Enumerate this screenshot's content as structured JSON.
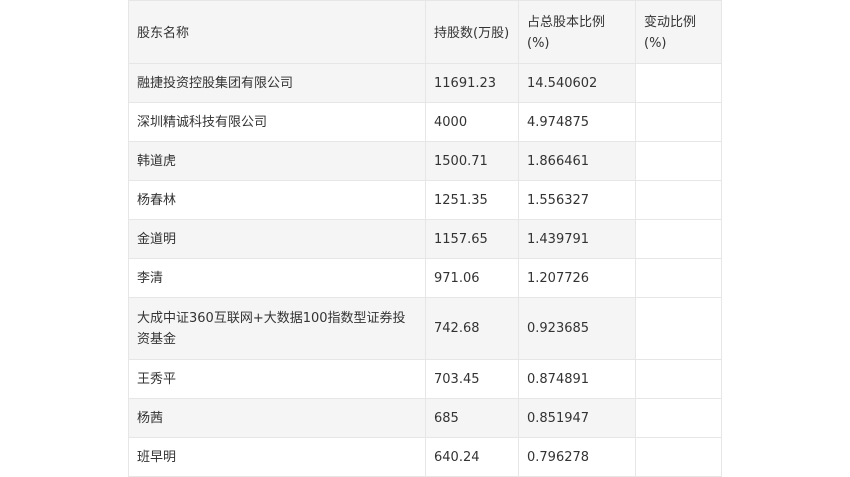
{
  "table": {
    "headers": [
      "股东名称",
      "持股数(万股)",
      "占总股本比例(%)",
      "变动比例(%)"
    ],
    "rows": [
      {
        "name": "融捷投资控股集团有限公司",
        "shares": "11691.23",
        "ratio": "14.540602",
        "change": ""
      },
      {
        "name": "深圳精诚科技有限公司",
        "shares": "4000",
        "ratio": "4.974875",
        "change": ""
      },
      {
        "name": "韩道虎",
        "shares": "1500.71",
        "ratio": "1.866461",
        "change": ""
      },
      {
        "name": "杨春林",
        "shares": "1251.35",
        "ratio": "1.556327",
        "change": ""
      },
      {
        "name": "金道明",
        "shares": "1157.65",
        "ratio": "1.439791",
        "change": ""
      },
      {
        "name": "李清",
        "shares": "971.06",
        "ratio": "1.207726",
        "change": ""
      },
      {
        "name": "大成中证360互联网+大数据100指数型证券投资基金",
        "shares": "742.68",
        "ratio": "0.923685",
        "change": ""
      },
      {
        "name": "王秀平",
        "shares": "703.45",
        "ratio": "0.874891",
        "change": ""
      },
      {
        "name": "杨茜",
        "shares": "685",
        "ratio": "0.851947",
        "change": ""
      },
      {
        "name": "班早明",
        "shares": "640.24",
        "ratio": "0.796278",
        "change": ""
      }
    ]
  }
}
